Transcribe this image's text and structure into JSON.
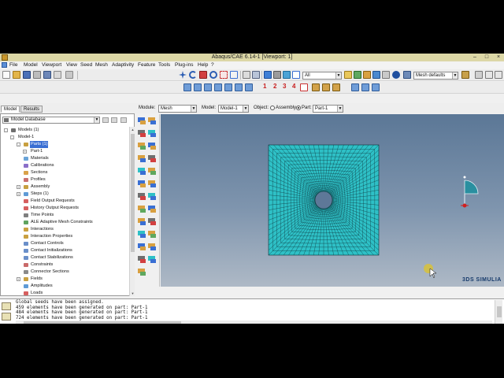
{
  "window": {
    "title": "Abaqus/CAE 6.14-1 [Viewport: 1]",
    "min_glyph": "–",
    "max_glyph": "□",
    "close_glyph": "×"
  },
  "menu": [
    "File",
    "Model",
    "Viewport",
    "View",
    "Seed",
    "Mesh",
    "Adaptivity",
    "Feature",
    "Tools",
    "Plug-ins",
    "Help",
    "?"
  ],
  "toolbar": {
    "selection_filter": "All",
    "mesh_defaults": "Mesh defaults",
    "viewport_numbers": [
      "1",
      "2",
      "3",
      "4"
    ]
  },
  "context": {
    "module_label": "Module:",
    "module_value": "Mesh",
    "model_label": "Model:",
    "model_value": "Model-1",
    "object_label": "Object:",
    "assembly_label": "Assembly",
    "part_label": "Part:",
    "part_value": "Part-1"
  },
  "left_panel": {
    "tabs": [
      "Model",
      "Results"
    ],
    "database": "Model Database",
    "tree": [
      {
        "label": "Models (1)",
        "level": 0,
        "expander": "-",
        "icon": "models-icon",
        "color": "#6f6f6f"
      },
      {
        "label": "Model-1",
        "level": 1,
        "expander": "-",
        "icon": "",
        "color": ""
      },
      {
        "label": "Parts (1)",
        "level": 2,
        "expander": "-",
        "icon": "parts-icon",
        "color": "#c8a040",
        "selected": true
      },
      {
        "label": "Part-1",
        "level": 3,
        "expander": "+",
        "icon": "",
        "color": ""
      },
      {
        "label": "Materials",
        "level": 2,
        "expander": "",
        "icon": "materials-icon",
        "color": "#6aa4d8"
      },
      {
        "label": "Calibrations",
        "level": 2,
        "expander": "",
        "icon": "calibrations-icon",
        "color": "#8a6fc9"
      },
      {
        "label": "Sections",
        "level": 2,
        "expander": "",
        "icon": "sections-icon",
        "color": "#d9a24a"
      },
      {
        "label": "Profiles",
        "level": 2,
        "expander": "",
        "icon": "profiles-icon",
        "color": "#c97070"
      },
      {
        "label": "Assembly",
        "level": 2,
        "expander": "+",
        "icon": "assembly-icon",
        "color": "#c8a040"
      },
      {
        "label": "Steps (1)",
        "level": 2,
        "expander": "+",
        "icon": "steps-icon",
        "color": "#5f9bd6"
      },
      {
        "label": "Field Output Requests",
        "level": 2,
        "expander": "",
        "icon": "field-output-icon",
        "color": "#d65f5f"
      },
      {
        "label": "History Output Requests",
        "level": 2,
        "expander": "",
        "icon": "history-output-icon",
        "color": "#d65f5f"
      },
      {
        "label": "Time Points",
        "level": 2,
        "expander": "",
        "icon": "time-points-icon",
        "color": "#7f7f7f"
      },
      {
        "label": "ALE Adaptive Mesh Constraints",
        "level": 2,
        "expander": "",
        "icon": "ale-icon",
        "color": "#5fa35f"
      },
      {
        "label": "Interactions",
        "level": 2,
        "expander": "",
        "icon": "interactions-icon",
        "color": "#c9a040"
      },
      {
        "label": "Interaction Properties",
        "level": 2,
        "expander": "",
        "icon": "interaction-properties-icon",
        "color": "#c9a040"
      },
      {
        "label": "Contact Controls",
        "level": 2,
        "expander": "",
        "icon": "contact-controls-icon",
        "color": "#6a8fc9"
      },
      {
        "label": "Contact Initializations",
        "level": 2,
        "expander": "",
        "icon": "contact-initializations-icon",
        "color": "#6a8fc9"
      },
      {
        "label": "Contact Stabilizations",
        "level": 2,
        "expander": "",
        "icon": "contact-stabilizations-icon",
        "color": "#6a8fc9"
      },
      {
        "label": "Constraints",
        "level": 2,
        "expander": "",
        "icon": "constraints-icon",
        "color": "#c96a6a"
      },
      {
        "label": "Connector Sections",
        "level": 2,
        "expander": "",
        "icon": "connector-sections-icon",
        "color": "#8a8a8a"
      },
      {
        "label": "Fields",
        "level": 2,
        "expander": "+",
        "icon": "fields-icon",
        "color": "#c9a040"
      },
      {
        "label": "Amplitudes",
        "level": 2,
        "expander": "",
        "icon": "amplitudes-icon",
        "color": "#5f9bd6"
      },
      {
        "label": "Loads",
        "level": 2,
        "expander": "",
        "icon": "loads-icon",
        "color": "#d65f5f"
      }
    ]
  },
  "viewport": {
    "axis_labels": {
      "x": "X",
      "y": "Y",
      "z": "Z"
    },
    "brand": "3DS SIMULIA",
    "mesh_color": "#2ec0c6",
    "mesh_line_color": "#0b2e35"
  },
  "messages": [
    "Global seeds have been assigned.",
    "459 elements have been generated on part: Part-1",
    "484 elements have been generated on part: Part-1",
    "724 elements have been generated on part: Part-1"
  ],
  "colors": {
    "title_bar": "#dcd7a6",
    "selection": "#3a6fd3",
    "viewport_top": "#5b7796",
    "viewport_bottom": "#aeb9c6"
  }
}
